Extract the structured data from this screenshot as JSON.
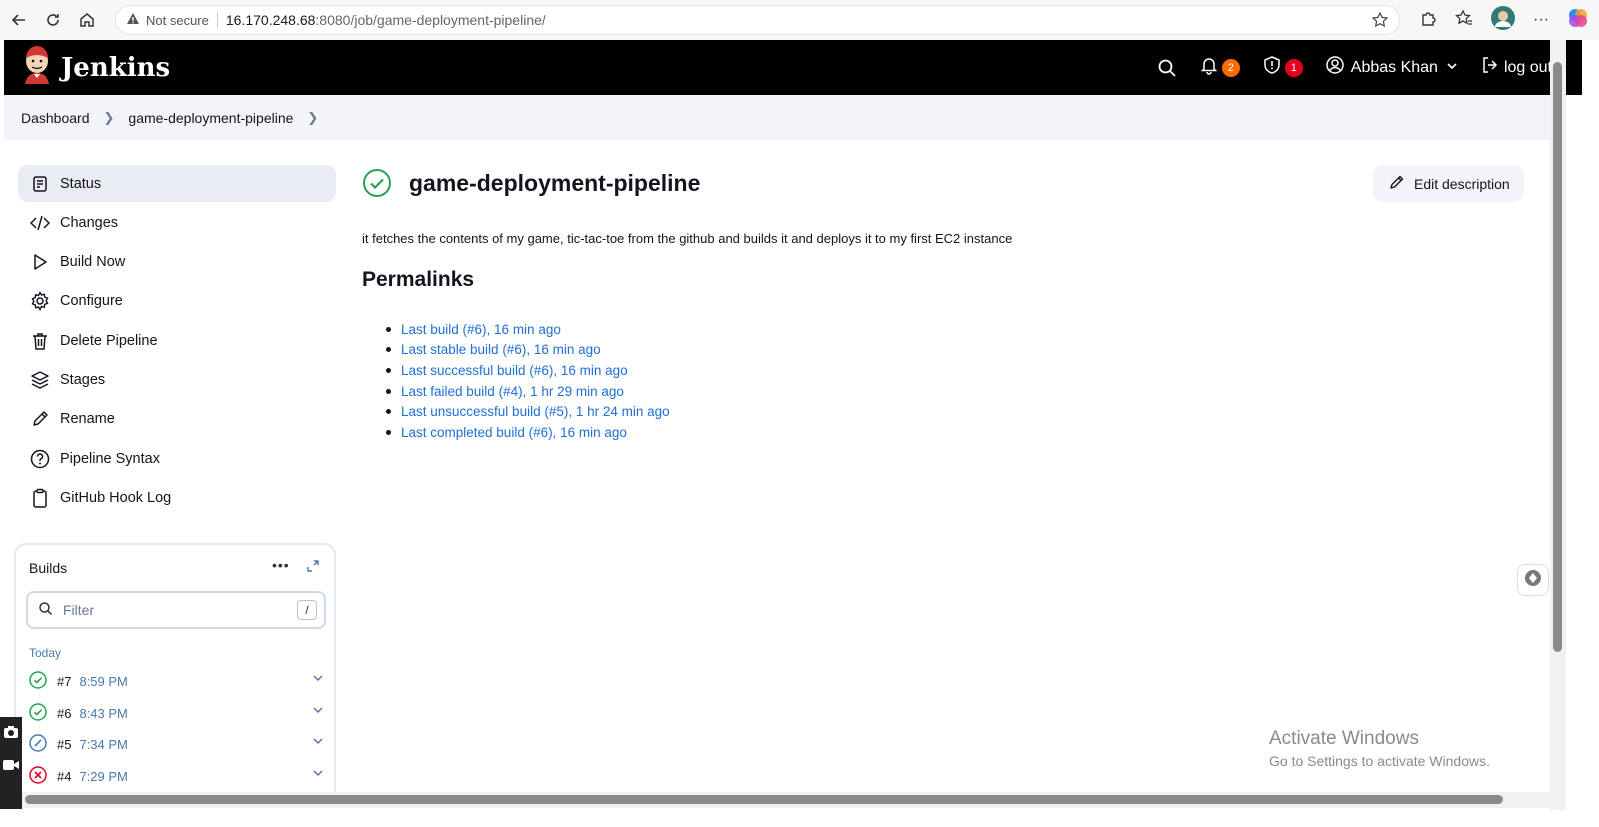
{
  "browser": {
    "security": "Not secure",
    "url_host": "16.170.248.68",
    "url_path": ":8080/job/game-deployment-pipeline/"
  },
  "header": {
    "brand": "Jenkins",
    "notifications_count": "2",
    "security_count": "1",
    "user_name": "Abbas Khan",
    "logout_label": "log out"
  },
  "breadcrumb": {
    "items": [
      "Dashboard",
      "game-deployment-pipeline"
    ]
  },
  "sidebar": {
    "items": [
      {
        "label": "Status",
        "icon": "document-icon"
      },
      {
        "label": "Changes",
        "icon": "code-icon"
      },
      {
        "label": "Build Now",
        "icon": "play-icon"
      },
      {
        "label": "Configure",
        "icon": "gear-icon"
      },
      {
        "label": "Delete Pipeline",
        "icon": "trash-icon"
      },
      {
        "label": "Stages",
        "icon": "layers-icon"
      },
      {
        "label": "Rename",
        "icon": "pencil-icon"
      },
      {
        "label": "Pipeline Syntax",
        "icon": "help-icon"
      },
      {
        "label": "GitHub Hook Log",
        "icon": "clipboard-icon"
      }
    ]
  },
  "builds": {
    "title": "Builds",
    "filter_placeholder": "Filter",
    "filter_shortcut": "/",
    "group_label": "Today",
    "rows": [
      {
        "num": "#7",
        "time": "8:59 PM",
        "status": "success"
      },
      {
        "num": "#6",
        "time": "8:43 PM",
        "status": "success"
      },
      {
        "num": "#5",
        "time": "7:34 PM",
        "status": "aborted"
      },
      {
        "num": "#4",
        "time": "7:29 PM",
        "status": "failed"
      }
    ]
  },
  "main": {
    "title": "game-deployment-pipeline",
    "edit_label": "Edit description",
    "description": "it fetches the contents of my game, tic-tac-toe from the github and builds it and deploys it to my first EC2 instance",
    "permalinks_title": "Permalinks",
    "permalinks": [
      "Last build (#6), 16 min ago",
      "Last stable build (#6), 16 min ago",
      "Last successful build (#6), 16 min ago",
      "Last failed build (#4), 1 hr 29 min ago",
      "Last unsuccessful build (#5), 1 hr 24 min ago",
      "Last completed build (#6), 16 min ago"
    ]
  },
  "watermark": {
    "line1": "Activate Windows",
    "line2": "Go to Settings to activate Windows."
  },
  "colors": {
    "success": "#1ea64b",
    "failed": "#e6001f",
    "aborted": "#4a78b0",
    "link": "#1f6fd6",
    "notif_badge": "#ff6a00",
    "security_badge": "#e6001f"
  }
}
